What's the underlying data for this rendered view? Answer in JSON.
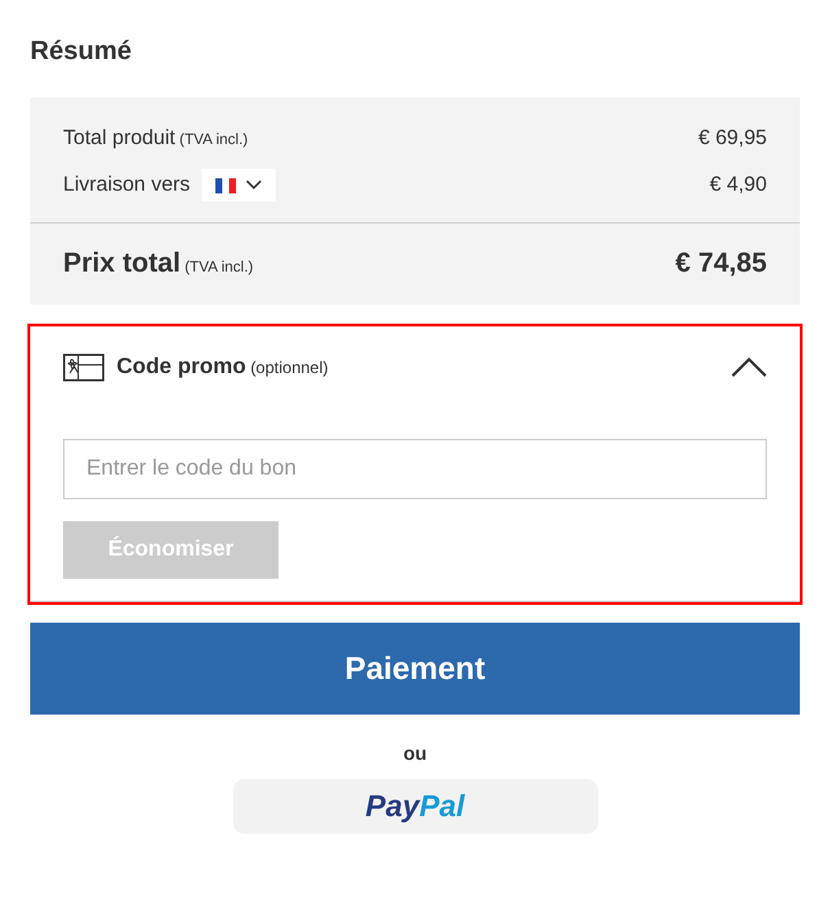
{
  "title": "Résumé",
  "summary": {
    "rows": [
      {
        "kind": "plain",
        "label": "Total produit",
        "note": "(TVA incl.)",
        "value": "€ 69,95"
      },
      {
        "kind": "country",
        "label": "Livraison vers",
        "value": "€ 4,90"
      }
    ],
    "total": {
      "label": "Prix total",
      "note": "(TVA incl.)",
      "value": "€ 74,85"
    }
  },
  "promo": {
    "highlighted": true,
    "expanded": true,
    "title": "Code promo",
    "note": "(optionnel)",
    "placeholder": "Entrer le code du bon",
    "button": {
      "label": "Économiser",
      "disabled": true
    }
  },
  "checkout_button": "Paiement",
  "separator": "ou",
  "paypal": {
    "logo_parts": [
      {
        "text": "Pay",
        "color": "#253b80"
      },
      {
        "text": "Pal",
        "color": "#179bd7"
      }
    ]
  }
}
